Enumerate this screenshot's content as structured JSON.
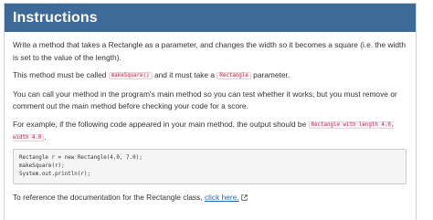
{
  "header": {
    "title": "Instructions"
  },
  "paragraphs": {
    "p1": "Write a method that takes a Rectangle as a parameter, and changes the width so it becomes a square (i.e. the width is set to the value of the length).",
    "p2_before": "This method must be called ",
    "p2_code1": "makeSquare()",
    "p2_middle": " and it must take a ",
    "p2_code2": "Rectangle",
    "p2_after": " parameter.",
    "p3": "You can call your method in the program's main method so you can test whether it works, but you must remove or comment out the main method before checking your code for a score.",
    "p4_before": "For example, if the following code appeared in your main method, the output should be ",
    "p4_code": "Rectangle with length 4.0, width 4.0",
    "p4_after": ".",
    "p5_before": "To reference the documentation for the Rectangle class, ",
    "p5_link": "click here."
  },
  "code_block": {
    "lines": [
      "Rectangle r = new Rectangle(4.0, 7.0);",
      "makeSquare(r);",
      "System.out.println(r);"
    ]
  },
  "icons": {
    "external_link": "external-link-icon"
  },
  "colors": {
    "header_bg": "#3d6a96",
    "inline_code": "#c7254e",
    "link": "#2a6aa8"
  }
}
